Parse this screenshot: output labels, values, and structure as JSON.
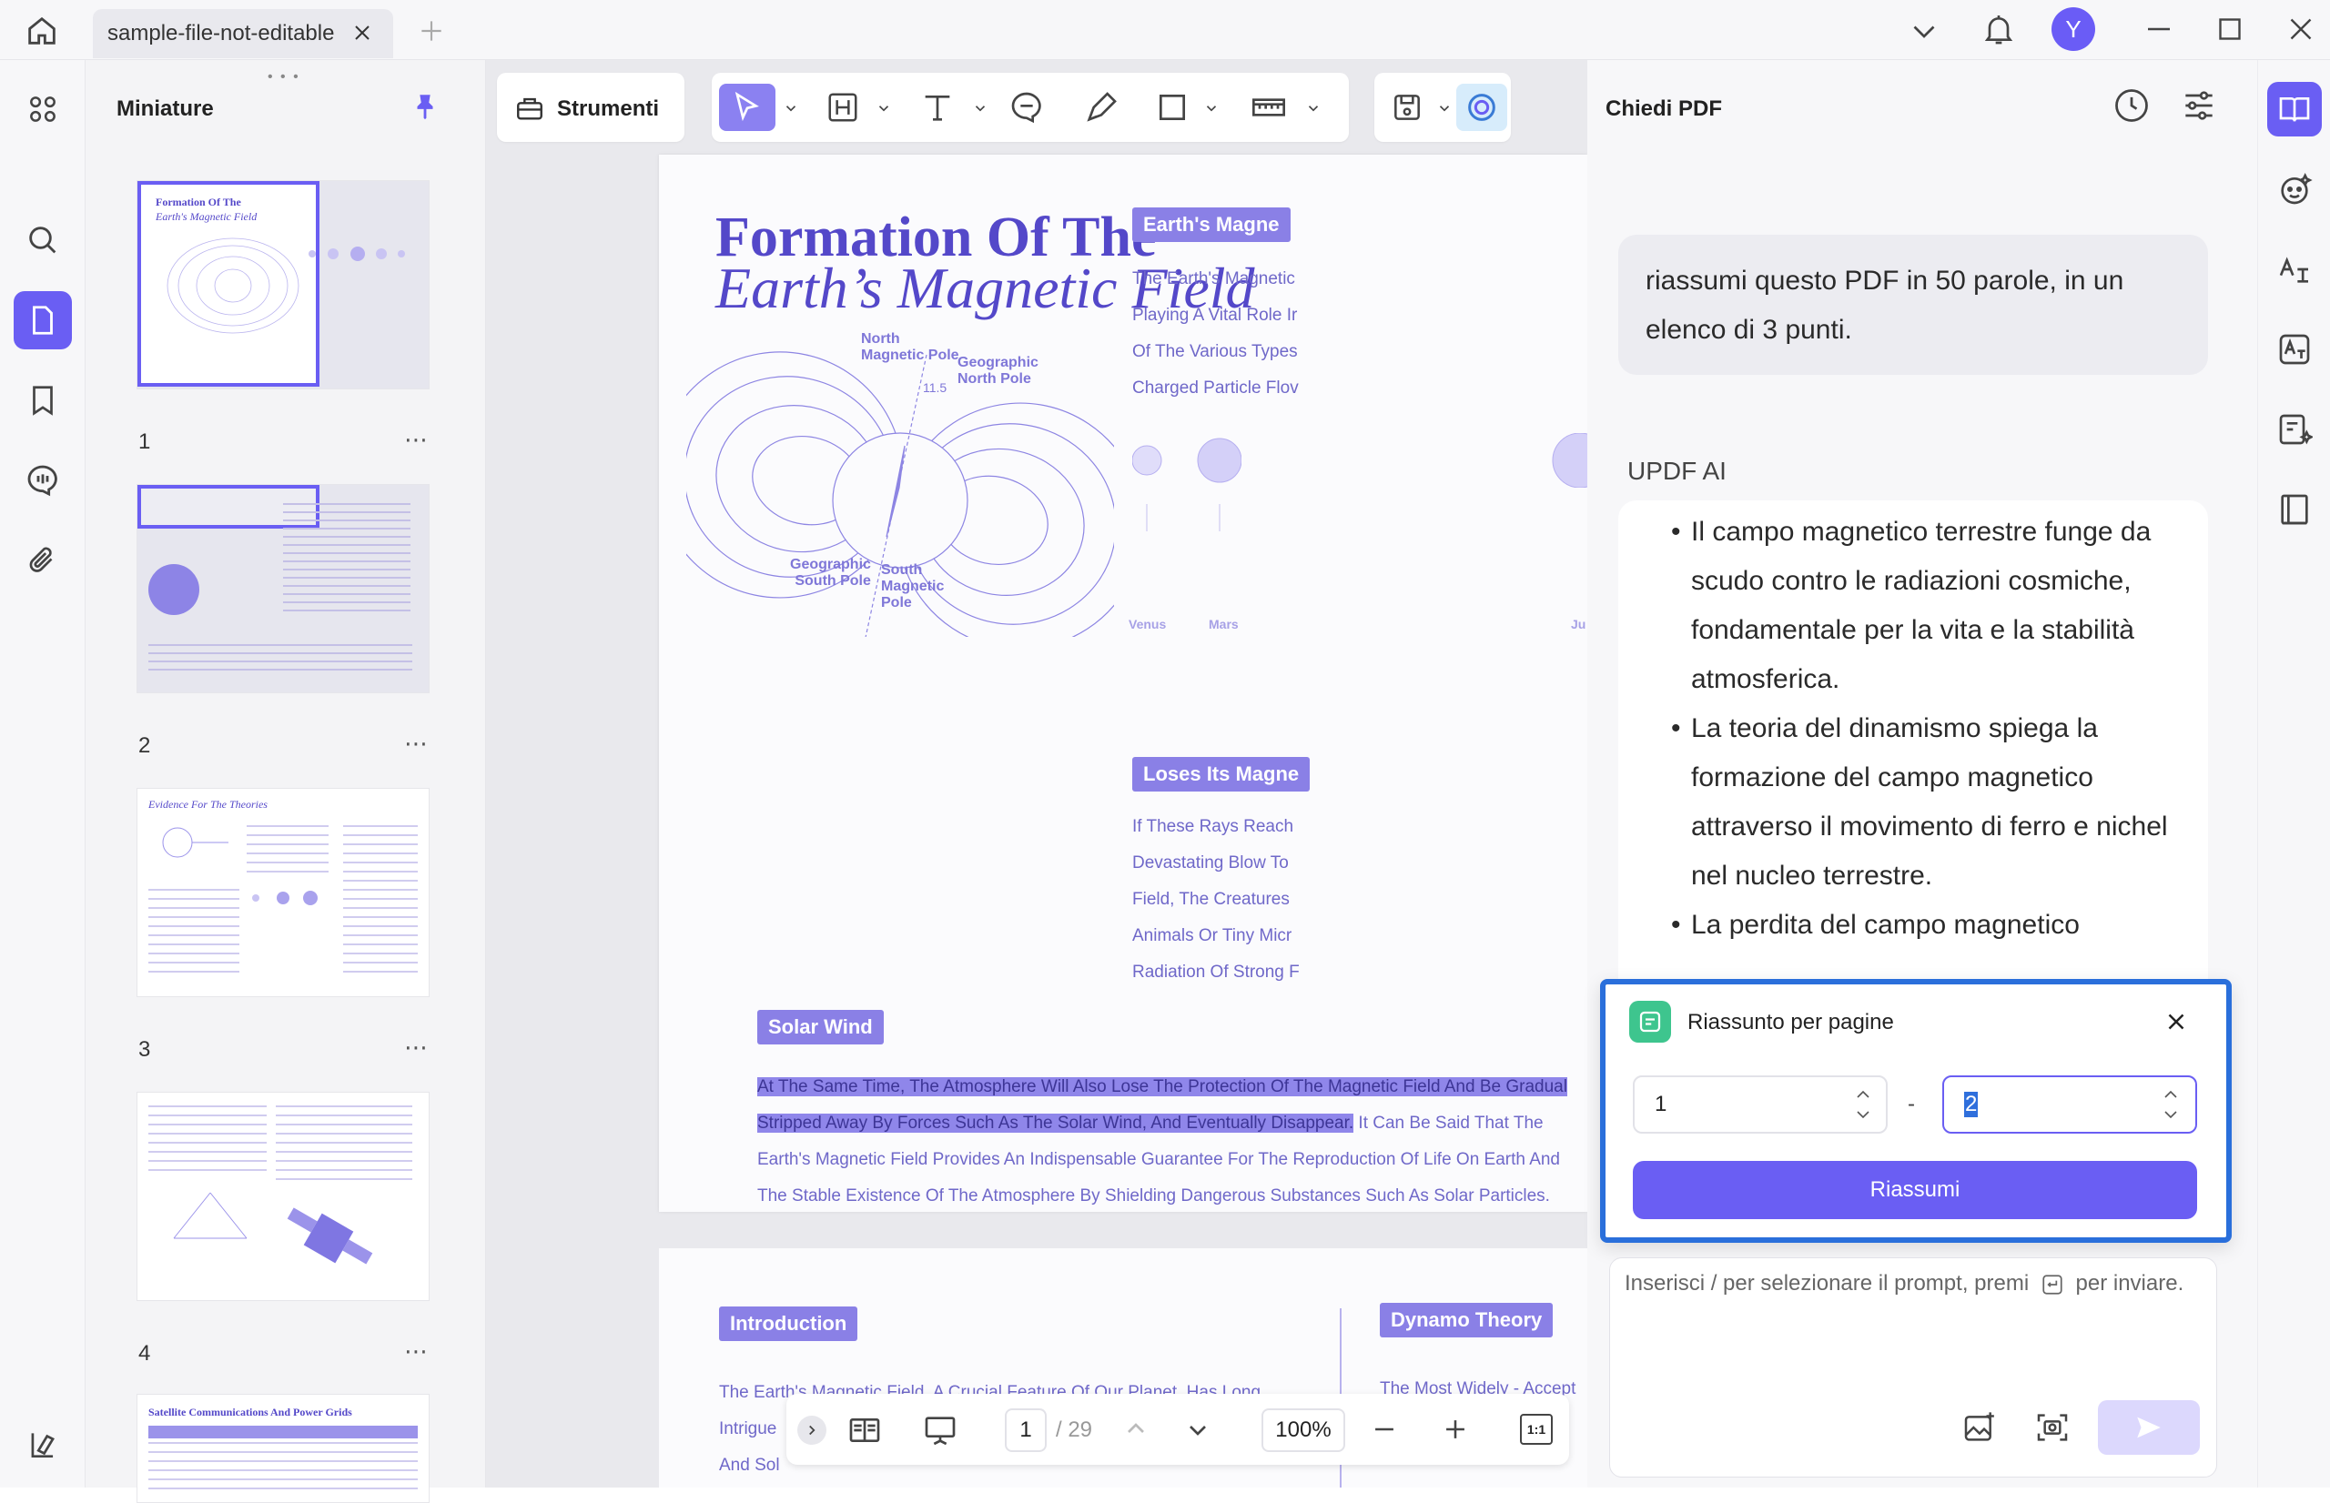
{
  "tab": {
    "title": "sample-file-not-editable"
  },
  "user": {
    "initial": "Y"
  },
  "thumbnails": {
    "header": "Miniature",
    "pages": [
      {
        "num": "1",
        "more": "⋯",
        "title": "Formation Of The",
        "subtitle": "Earth's Magnetic Field"
      },
      {
        "num": "2",
        "more": "⋯"
      },
      {
        "num": "3",
        "more": "⋯",
        "title": "Evidence For The Theories"
      },
      {
        "num": "4",
        "more": "⋯"
      },
      {
        "title": "Satellite Communications And Power Grids"
      }
    ]
  },
  "toolbar": {
    "strumenti": "Strumenti"
  },
  "document": {
    "title_line1": "Formation Of The",
    "title_line2": "Earth’s Magnetic Field",
    "diagram": {
      "north_magnetic": [
        "North",
        "Magnetic Pole"
      ],
      "geo_north": [
        "Geographic",
        "North Pole"
      ],
      "angle": "11.5",
      "geo_south": [
        "Geographic",
        "South Pole"
      ],
      "south_magnetic": [
        "South",
        "Magnetic",
        "Pole"
      ]
    },
    "side1_tag": "Earth's Magne",
    "side1_lines": [
      "The Earth's Magnetic",
      "Playing A Vital Role Ir",
      "Of The Various Types",
      "Charged Particle Flov"
    ],
    "planets": [
      "Venus",
      "Mars",
      "Ju"
    ],
    "side2_tag": "Loses Its Magne",
    "side2_lines": [
      "If These Rays Reach",
      "Devastating Blow To",
      "Field, The Creatures",
      "Animals Or Tiny Micr",
      "Radiation Of Strong F"
    ],
    "solar_tag": "Solar Wind",
    "solar_hl1": "At The Same Time, The Atmosphere Will Also Lose The Protection Of The Magnetic Field And Be Gradual",
    "solar_hl2": "Stripped Away By Forces Such As The Solar Wind, And Eventually Disappear.",
    "solar_rest2": " It Can Be Said That The",
    "solar_line3": "Earth's Magnetic Field Provides An Indispensable Guarantee For The Reproduction Of Life On Earth And",
    "solar_line4": "The Stable Existence Of The Atmosphere By Shielding Dangerous Substances Such As Solar Particles.",
    "page2_intro_tag": "Introduction",
    "page2_intro_lines": [
      "The Earth's Magnetic Field, A Crucial Feature Of Our Planet, Has Long",
      "Intrigue",
      "And Sol"
    ],
    "page2_dynamo_tag": "Dynamo Theory",
    "page2_dynamo_line": "The Most Widely - Accept"
  },
  "bottom": {
    "page": "1",
    "total": "/ 29",
    "zoom": "100%",
    "fit": "1:1"
  },
  "chat": {
    "title": "Chiedi PDF",
    "prompt": "riassumi questo PDF in 50 parole, in un elenco di 3 punti.",
    "ai_label": "UPDF AI",
    "bullets": [
      "Il campo magnetico terrestre funge da scudo contro le radiazioni cosmiche, fondamentale per la vita e la stabilità atmosferica.",
      "La teoria del dinamismo spiega la formazione del campo magnetico attraverso il movimento di ferro e nichel nel nucleo terrestre.",
      "La perdita del campo magnetico"
    ],
    "popup": {
      "title": "Riassunto per pagine",
      "from": "1",
      "sep": "-",
      "to": "2",
      "button": "Riassumi"
    },
    "input_placeholder_a": "Inserisci / per selezionare il prompt, premi",
    "input_placeholder_b": "per inviare."
  },
  "colors": {
    "accent": "#6a5ef3",
    "highlight": "#8f86ea",
    "popup_border": "#2a6fdb"
  }
}
